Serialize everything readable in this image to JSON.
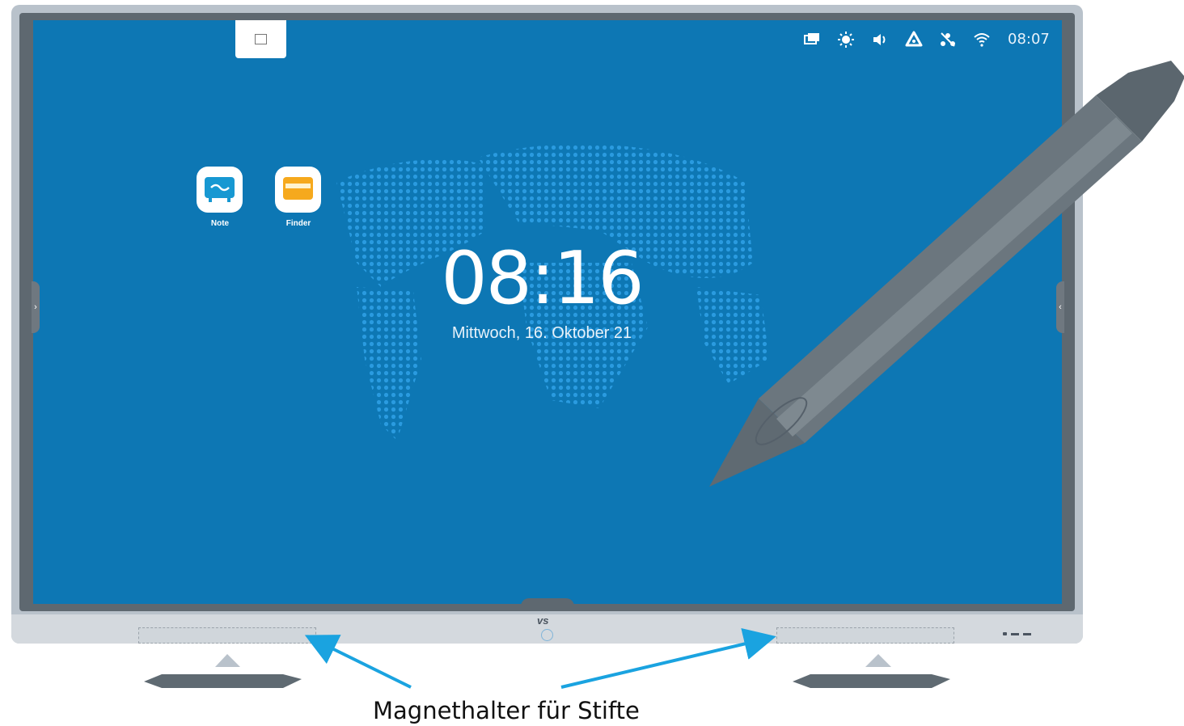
{
  "status_bar": {
    "icons": [
      "screen-mirror-icon",
      "brightness-icon",
      "volume-icon",
      "cloud-icon",
      "usb-icon",
      "wifi-icon"
    ],
    "time": "08:07"
  },
  "apps": [
    {
      "label": "Note",
      "icon": "note-icon"
    },
    {
      "label": "Finder",
      "icon": "folder-icon"
    }
  ],
  "clock": {
    "time": "08:16",
    "date": "Mittwoch, 16. Oktober 21"
  },
  "bezel": {
    "logo": "VS"
  },
  "caption": "Magnethalter für Stifte",
  "colors": {
    "screen": "#0d77b4",
    "bezel": "#b9c2cb",
    "pen": "#5f6a72",
    "arrow": "#1aa3e0"
  }
}
